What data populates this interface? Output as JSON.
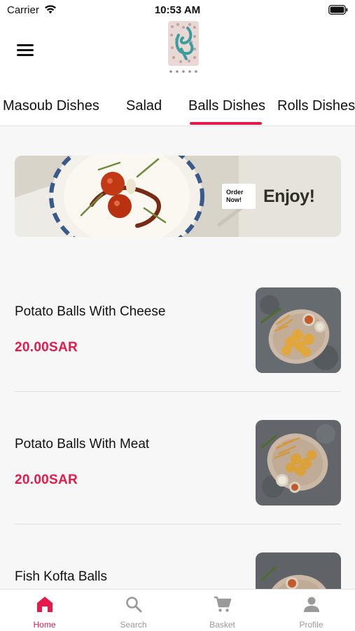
{
  "status_bar": {
    "carrier": "Carrier",
    "time": "10:53 AM"
  },
  "header": {
    "menu_icon": "hamburger-menu-icon"
  },
  "category_tabs": [
    {
      "label": "Masoub Dishes",
      "selected": false
    },
    {
      "label": "Salad",
      "selected": false
    },
    {
      "label": "Balls Dishes",
      "selected": true
    },
    {
      "label": "Rolls Dishes",
      "selected": false
    }
  ],
  "banner": {
    "order_line1": "Order",
    "order_line2": "Now!",
    "headline": "Enjoy!"
  },
  "menu_items": [
    {
      "name": "Potato Balls With Cheese",
      "price": "20.00SAR"
    },
    {
      "name": "Potato Balls With Meat",
      "price": "20.00SAR"
    },
    {
      "name": "Fish Kofta Balls",
      "price": ""
    }
  ],
  "tab_bar": [
    {
      "label": "Home",
      "icon": "home-icon",
      "active": true
    },
    {
      "label": "Search",
      "icon": "search-icon",
      "active": false
    },
    {
      "label": "Basket",
      "icon": "cart-icon",
      "active": false
    },
    {
      "label": "Profile",
      "icon": "profile-icon",
      "active": false
    }
  ],
  "colors": {
    "accent": "#e8194a",
    "background": "#f7f7f7",
    "inactive": "#9a9a9a"
  }
}
